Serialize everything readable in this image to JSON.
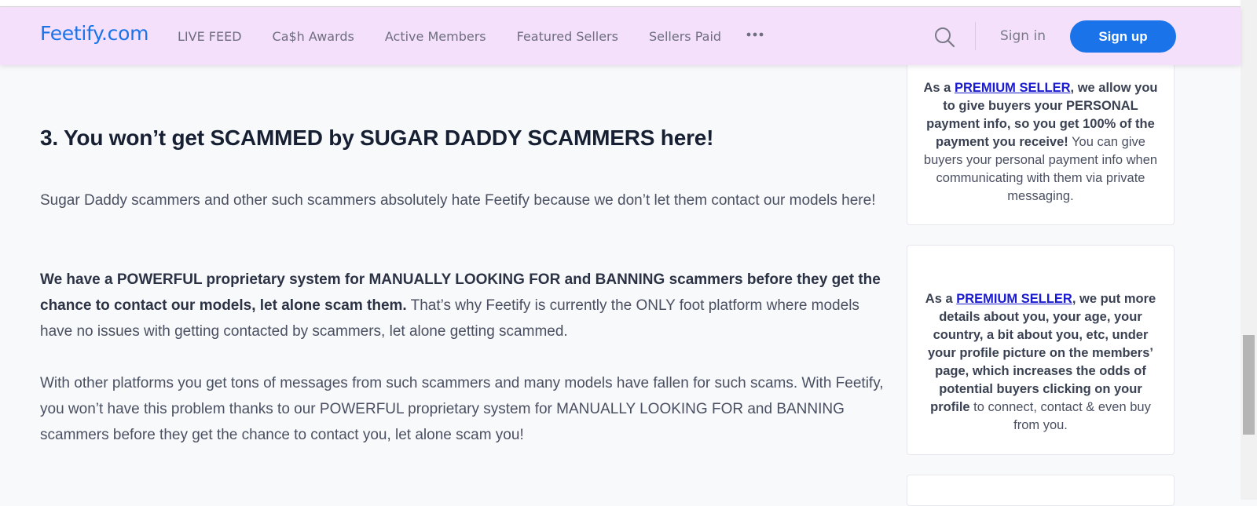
{
  "header": {
    "logo": "Feetify.com",
    "nav": [
      "LIVE FEED",
      "Ca$h Awards",
      "Active Members",
      "Featured Sellers",
      "Sellers Paid"
    ],
    "signin": "Sign in",
    "signup": "Sign up"
  },
  "article": {
    "heading": "3. You won’t get SCAMMED by SUGAR DADDY SCAMMERS here!",
    "p1": "Sugar Daddy scammers and other such scammers absolutely hate Feetify because we don’t let them contact our models here!",
    "p2_bold": "We have a POWERFUL proprietary system for MANUALLY LOOKING FOR and BANNING scammers before they get the chance to contact our models, let alone scam them.",
    "p2_rest": " That’s why Feetify is currently the ONLY foot platform where models have no issues with getting contacted by scammers, let alone getting scammed.",
    "p3": "With other platforms you get tons of messages from such scammers and many models have fallen for such scams. With Feetify, you won’t have this problem thanks to our POWERFUL proprietary system for MANUALLY LOOKING FOR and BANNING scammers before they get the chance to contact you, let alone scam you!"
  },
  "sidebar": {
    "card1": {
      "prefix": "As a ",
      "link": "PREMIUM SELLER",
      "bold": ", we allow you to give buyers your PERSONAL payment info, so you get 100% of the payment you receive!",
      "rest": " You can give buyers your personal payment info when communicating with them via private messaging."
    },
    "card2": {
      "prefix": "As a ",
      "link": "PREMIUM SELLER",
      "bold": ", we put more details about you, your age, your country, a bit about you, etc, under your profile picture on the members’ page, which increases the odds of potential buyers clicking on your profile",
      "rest": " to connect, contact & even buy from you."
    }
  },
  "colors": {
    "header_bg": "#f4e0fb",
    "brand": "#1a73e8",
    "link": "#1a1ad0"
  }
}
